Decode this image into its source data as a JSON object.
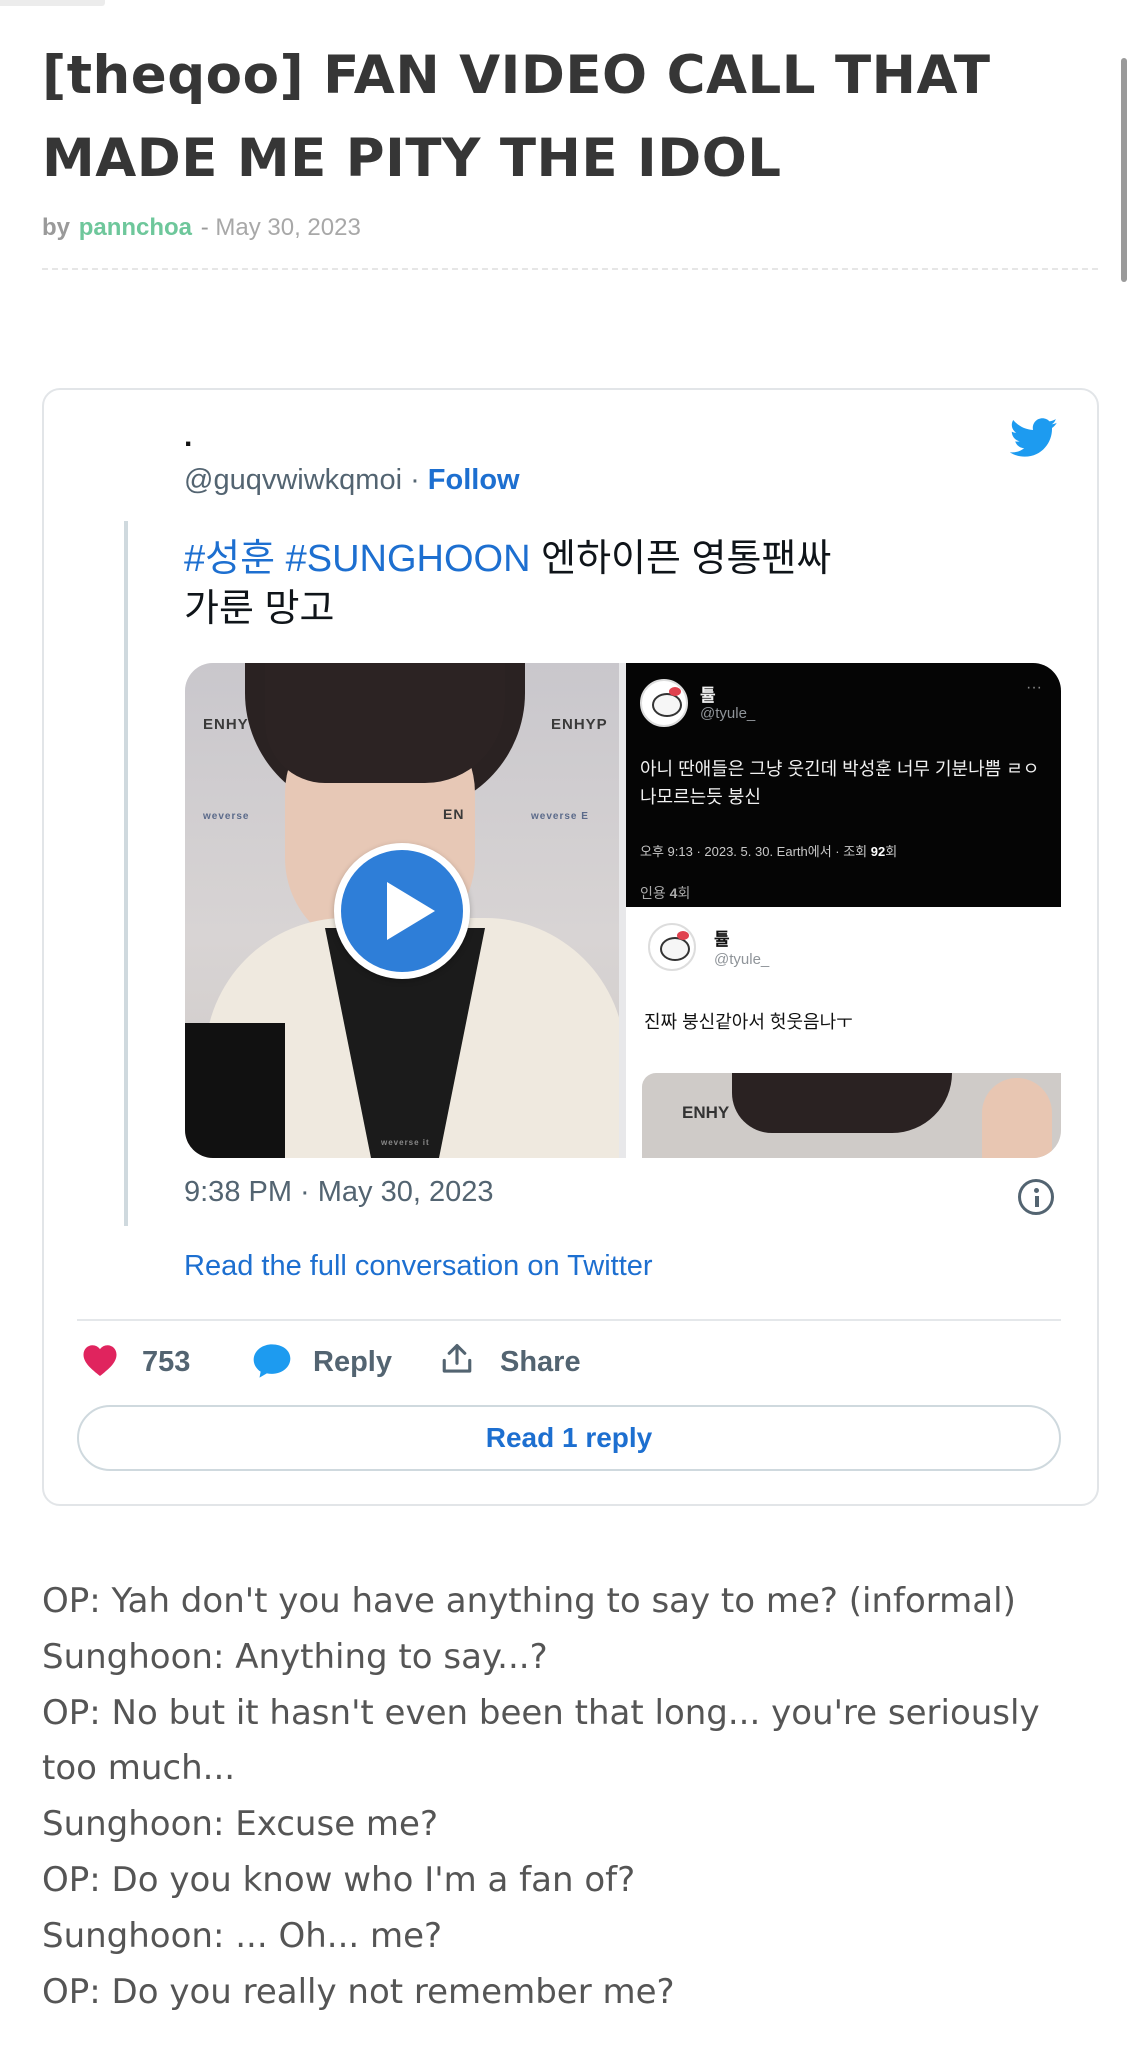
{
  "article": {
    "title": "[theqoo] FAN VIDEO CALL THAT MADE ME PITY THE IDOL",
    "byline_prefix": "by",
    "author": "pannchoa",
    "separator": " - ",
    "date": "May 30, 2023"
  },
  "tweet": {
    "display_name": ".",
    "handle": "@guqvwiwkqmoi",
    "handle_sep": " · ",
    "follow_label": "Follow",
    "hashtags": [
      "#성훈",
      "#SUNGHOON"
    ],
    "text_line1": "엔하이픈 영통팬싸",
    "text_line2": "가룬 망고",
    "timestamp": "9:38 PM · May 30, 2023",
    "read_conversation_label": "Read the full conversation on Twitter",
    "likes": "753",
    "reply_label": "Reply",
    "share_label": "Share",
    "read_reply_label": "Read 1 reply",
    "media": {
      "left_logo_1": "ENHY",
      "left_logo_2": "ENHYP",
      "left_logo_3": "weverse",
      "left_logo_4": "weverse E",
      "left_logo_5": "EN",
      "left_logo_6": "weverse it",
      "embedded_1": {
        "name": "튤",
        "handle": "@tyule_",
        "body_line1": "아니 딴애들은 그냥 웃긴데 박성훈 너무 기분나쁨 ㄹㅇ",
        "body_line2": "나모르는듯 붕신",
        "meta_prefix": "오후 9:13 · 2023. 5. 30. Earth에서 · 조회 ",
        "meta_views": "92",
        "meta_suffix": "회",
        "quote_prefix": "인용 ",
        "quote_count": "4",
        "quote_suffix": "회",
        "more": "···"
      },
      "embedded_2": {
        "name": "튤",
        "handle": "@tyule_",
        "body": "진짜 붕신같아서 헛웃음나ㅜ"
      },
      "thumb_logo": "ENHY"
    }
  },
  "transcript": [
    "OP: Yah don't you have anything to say to me? (informal)",
    "Sunghoon:  Anything to say...?",
    "OP: No but it hasn't even been that long... you're seriously too much...",
    "Sunghoon: Excuse me?",
    "OP: Do you know who I'm a fan of?",
    "Sunghoon: ... Oh... me?",
    "OP: Do you really not remember me?"
  ],
  "colors": {
    "author_green": "#6ec79b",
    "twitter_blue": "#1d6fd0",
    "heart_pink": "#e0245e",
    "play_blue": "#2e7ed8"
  },
  "icons": [
    "twitter-bird-icon",
    "play-icon",
    "info-icon",
    "heart-icon",
    "reply-bubble-icon",
    "share-icon"
  ]
}
